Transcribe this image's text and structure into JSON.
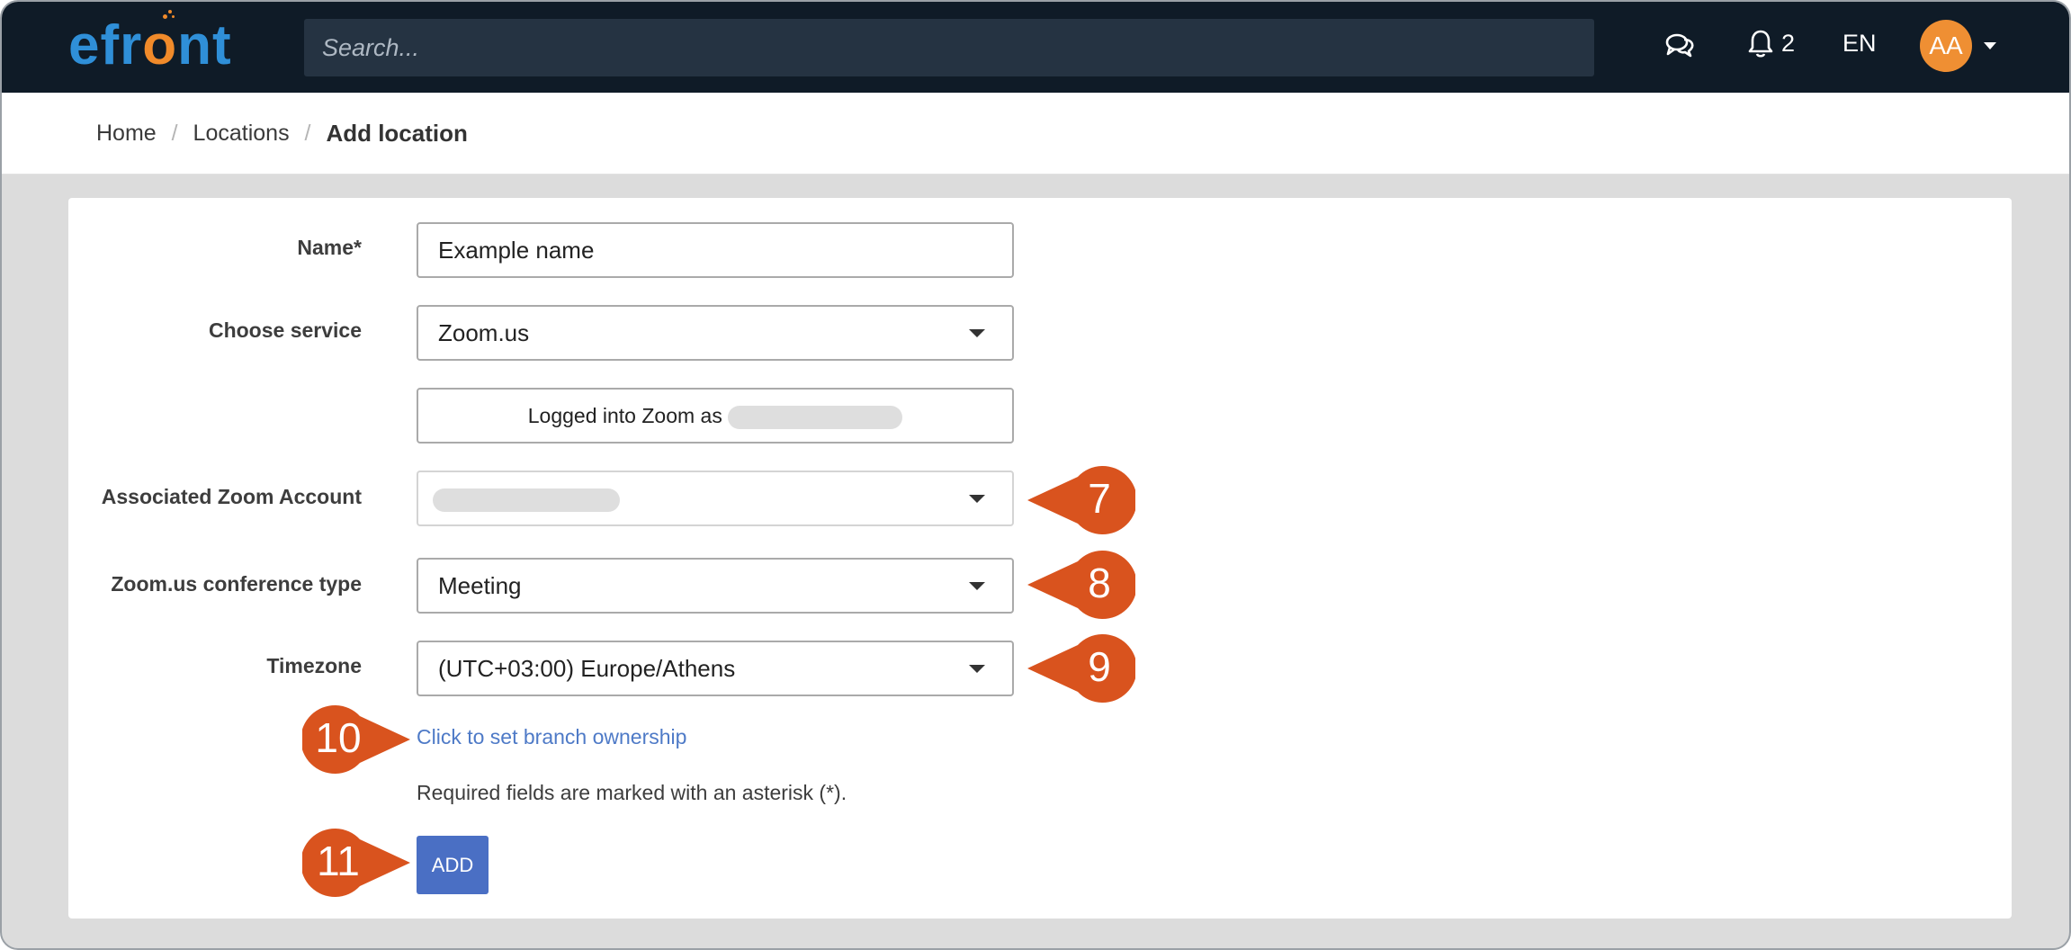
{
  "header": {
    "logo_text_left": "efr",
    "logo_text_o": "o",
    "logo_text_right": "nt",
    "search": {
      "placeholder": "Search..."
    },
    "notifications_count": "2",
    "language": "EN",
    "avatar_initials": "AA"
  },
  "breadcrumb": {
    "items": [
      "Home",
      "Locations"
    ],
    "current": "Add location",
    "separator": "/"
  },
  "form": {
    "name": {
      "label": "Name*",
      "value": "Example name"
    },
    "service": {
      "label": "Choose service",
      "value": "Zoom.us"
    },
    "logged_in_text": "Logged into Zoom as",
    "zoom_account": {
      "label": "Associated Zoom Account"
    },
    "conference_type": {
      "label": "Zoom.us conference type",
      "value": "Meeting"
    },
    "timezone": {
      "label": "Timezone",
      "value": "(UTC+03:00) Europe/Athens"
    },
    "branch_link": "Click to set branch ownership",
    "required_note": "Required fields are marked with an asterisk (*).",
    "add_button": "ADD"
  },
  "callouts": [
    "7",
    "8",
    "9",
    "10",
    "11"
  ],
  "colors": {
    "topbar": "#0f1b27",
    "brand_blue": "#2f8fd8",
    "brand_orange": "#f08a2a",
    "callout": "#d9531e",
    "button": "#4a6fc4",
    "link": "#4e7ac7"
  }
}
